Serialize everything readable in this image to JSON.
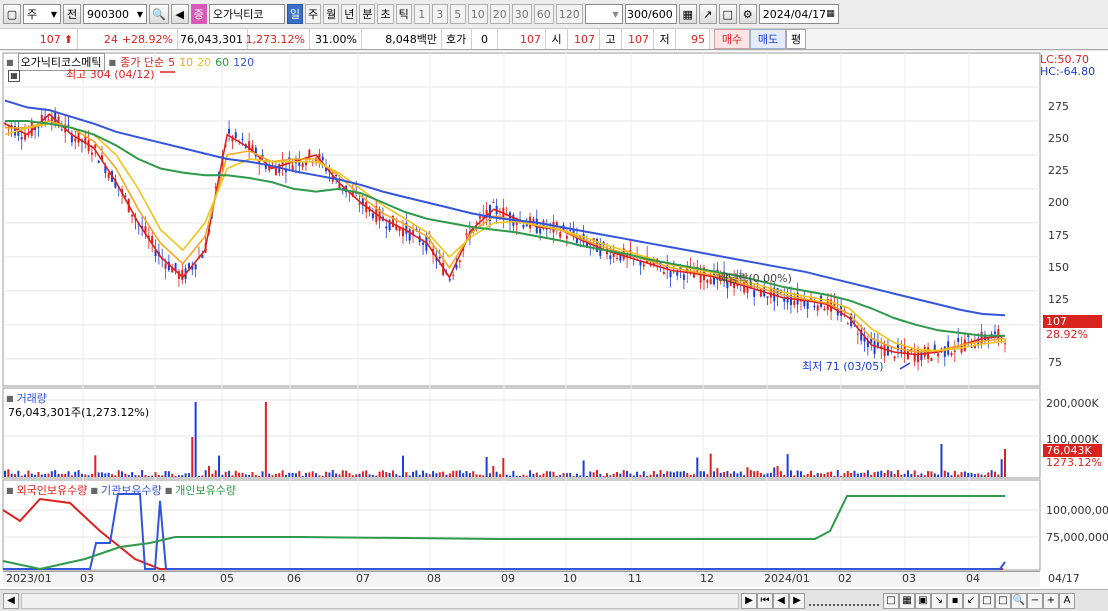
{
  "toolbar": {
    "period_select": "주",
    "prev_label": "전",
    "stock_code": "900300",
    "stock_name": "오가닉티코",
    "name_badge": "증",
    "timeframes": [
      "일",
      "주",
      "월",
      "년",
      "분",
      "초",
      "틱"
    ],
    "active_timeframe": "일",
    "minute_options": [
      "1",
      "3",
      "5",
      "10",
      "20",
      "30",
      "60",
      "120"
    ],
    "count_value": "300",
    "count_max": "/600",
    "date_value": "2024/04/17"
  },
  "quote": {
    "price": "107",
    "change": "24",
    "change_pct": "+28.92%",
    "volume": "76,043,301",
    "volume_pct": "1,273.12%",
    "turnover": "31.00%",
    "amount": "8,048백만",
    "hoga_label": "호가",
    "hoga_value": "0",
    "hoga_price": "107",
    "open_label": "시",
    "open_value": "107",
    "high_label": "고",
    "high_value": "107",
    "low_label": "저",
    "low_value": "95",
    "buy_button": "매수",
    "sell_button": "매도",
    "eval_button": "평"
  },
  "price_panel": {
    "title": "오가닉티코스메틱",
    "ma_label": "종가 단순",
    "ma_periods": [
      "5",
      "10",
      "20",
      "60",
      "120"
    ],
    "ma_colors": [
      "#e0201c",
      "#f5a623",
      "#f0c419",
      "#2e9a4a",
      "#3355d8"
    ],
    "high_annotation": "최고 304 (04/12)",
    "low_annotation": "최저 71 (03/05)",
    "dividend_annotation": "배당락(0.00%)",
    "lc": "LC:50.70",
    "hc": "HC:-64.80",
    "current_price_box": "107",
    "current_change_box": "28.92%",
    "y_ticks": [
      "275",
      "250",
      "225",
      "200",
      "175",
      "150",
      "125",
      "75"
    ]
  },
  "volume_panel": {
    "title": "거래량",
    "value_text": "76,043,301주(1,273.12%)",
    "y_ticks": [
      "200,000K",
      "100,000K"
    ],
    "current_box": "76,043K",
    "current_pct": "1273.12%"
  },
  "holding_panel": {
    "legend": [
      "외국인보유수량",
      "기관보유수량",
      "개인보유수량"
    ],
    "legend_colors": [
      "#e0201c",
      "#3355d8",
      "#2e9a4a"
    ],
    "y_ticks": [
      "100,000,000",
      "75,000,000"
    ]
  },
  "x_axis": {
    "labels": [
      "2023/01",
      "03",
      "04",
      "05",
      "06",
      "07",
      "08",
      "09",
      "10",
      "11",
      "12",
      "2024/01",
      "02",
      "03",
      "04"
    ],
    "last_date": "04/17"
  },
  "chart_data": {
    "type": "line",
    "title": "",
    "ylim": [
      55,
      300
    ],
    "series": [
      {
        "name": "5",
        "values": [
          248,
          240,
          255,
          240,
          230,
          205,
          175,
          150,
          135,
          155,
          240,
          230,
          215,
          220,
          225,
          205,
          190,
          178,
          170,
          160,
          135,
          170,
          185,
          178,
          172,
          170,
          162,
          155,
          150,
          145,
          140,
          138,
          135,
          130,
          125,
          120,
          118,
          115,
          105,
          85,
          80,
          78,
          80,
          85,
          90,
          92
        ]
      },
      {
        "name": "10",
        "values": [
          245,
          245,
          250,
          245,
          235,
          215,
          185,
          160,
          145,
          165,
          225,
          228,
          220,
          222,
          222,
          210,
          195,
          182,
          174,
          165,
          142,
          168,
          180,
          177,
          173,
          170,
          163,
          157,
          152,
          147,
          142,
          139,
          136,
          131,
          127,
          122,
          119,
          116,
          108,
          90,
          83,
          80,
          81,
          85,
          88,
          90
        ]
      },
      {
        "name": "20",
        "values": [
          240,
          245,
          248,
          245,
          240,
          225,
          200,
          170,
          155,
          175,
          215,
          222,
          220,
          220,
          220,
          212,
          200,
          188,
          178,
          168,
          150,
          165,
          175,
          176,
          173,
          170,
          165,
          159,
          154,
          149,
          144,
          141,
          138,
          133,
          129,
          124,
          121,
          118,
          112,
          97,
          87,
          82,
          81,
          83,
          86,
          88
        ]
      },
      {
        "name": "60",
        "values": [
          250,
          250,
          248,
          245,
          240,
          232,
          222,
          215,
          212,
          210,
          210,
          208,
          205,
          200,
          198,
          200,
          197,
          190,
          183,
          178,
          175,
          172,
          170,
          168,
          165,
          162,
          158,
          155,
          152,
          148,
          145,
          142,
          139,
          136,
          132,
          128,
          125,
          122,
          118,
          112,
          105,
          100,
          96,
          94,
          92,
          92
        ]
      },
      {
        "name": "120",
        "values": [
          265,
          260,
          258,
          253,
          248,
          242,
          238,
          234,
          230,
          226,
          222,
          220,
          217,
          213,
          210,
          207,
          203,
          198,
          194,
          190,
          186,
          182,
          179,
          177,
          175,
          172,
          169,
          166,
          163,
          160,
          157,
          154,
          151,
          148,
          145,
          142,
          139,
          135,
          131,
          127,
          123,
          119,
          115,
          111,
          108,
          107
        ]
      }
    ]
  }
}
